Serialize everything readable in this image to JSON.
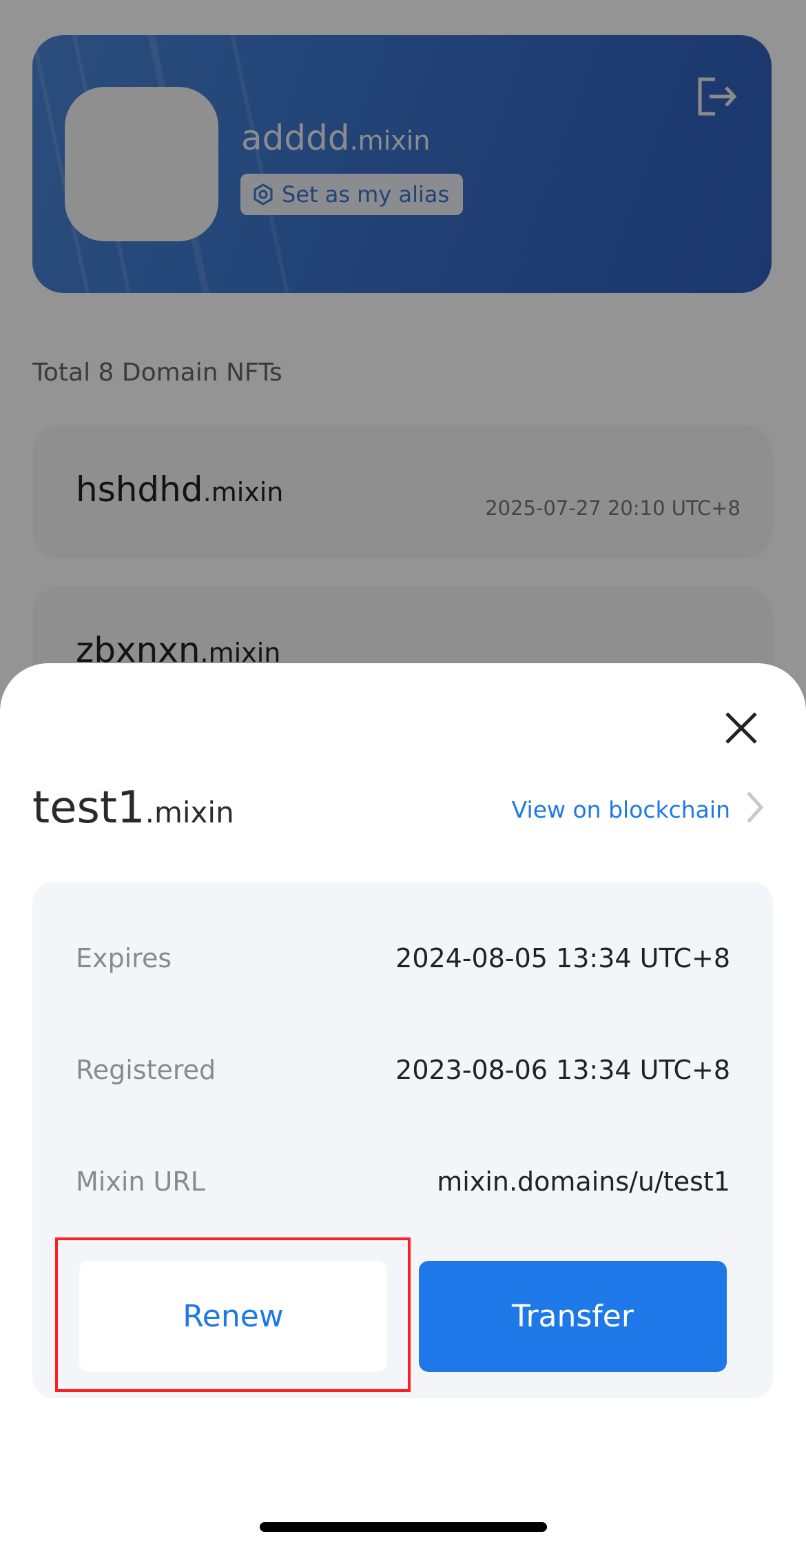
{
  "header": {
    "alias_name": "adddd",
    "alias_suffix": ".mixin",
    "set_alias_label": "Set as my alias",
    "logout_icon": "logout-icon"
  },
  "list": {
    "total_label": "Total 8 Domain NFTs",
    "items": [
      {
        "name": "hshdhd",
        "suffix": ".mixin",
        "date": "2025-07-27 20:10 UTC+8"
      },
      {
        "name": "zbxnxn",
        "suffix": ".mixin",
        "date": ""
      }
    ]
  },
  "sheet": {
    "domain_name": "test1",
    "domain_suffix": ".mixin",
    "view_on_blockchain": "View on blockchain",
    "rows": [
      {
        "label": "Expires",
        "value": "2024-08-05 13:34 UTC+8"
      },
      {
        "label": "Registered",
        "value": "2023-08-06 13:34 UTC+8"
      },
      {
        "label": "Mixin URL",
        "value": "mixin.domains/u/test1"
      }
    ],
    "renew_label": "Renew",
    "transfer_label": "Transfer"
  },
  "colors": {
    "accent": "#1f78e8",
    "highlight": "#ff1f1f",
    "panel": "#f4f5f9"
  }
}
